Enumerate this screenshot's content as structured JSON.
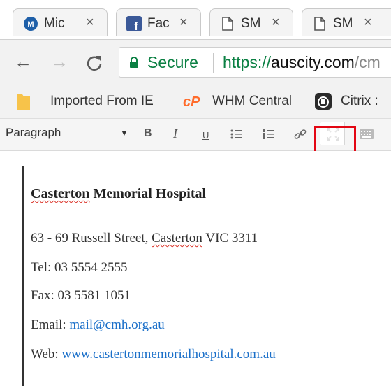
{
  "tabs": [
    {
      "title": "Mic",
      "icon": "m-badge-icon",
      "close": "×"
    },
    {
      "title": "Fac",
      "icon": "facebook-icon",
      "close": "×"
    },
    {
      "title": "SM",
      "icon": "document-icon",
      "close": "×"
    },
    {
      "title": "SM",
      "icon": "document-icon",
      "close": "×"
    }
  ],
  "nav": {
    "back": "←",
    "forward": "→",
    "reload": "C",
    "secure_label": "Secure",
    "url_scheme": "https://",
    "url_host": "auscity.com",
    "url_path": "/cm"
  },
  "bookmarks": [
    {
      "label": "Imported From IE",
      "icon": "folder-icon"
    },
    {
      "label": "WHM Central",
      "icon": "cpanel-icon"
    },
    {
      "label": "Citrix :",
      "icon": "citrix-icon"
    }
  ],
  "toolbar": {
    "format": "Paragraph",
    "caret": "▼",
    "bold": "B",
    "italic": "I",
    "underline": "U",
    "bullet_list": "☰",
    "numbered_list": "☰",
    "link": "🔗"
  },
  "content": {
    "heading_word1": "Casterton",
    "heading_rest": " Memorial Hospital",
    "address_pre": "63 - 69 Russell Street, ",
    "address_town": "Casterton",
    "address_post": " VIC 3311",
    "tel": "Tel: 03 5554 2555",
    "fax": "Fax: 03 5581 1051",
    "email_label": "Email: ",
    "email": "mail@cmh.org.au",
    "web_label": "Web: ",
    "web": "www.castertonmemorialhospital.com.au"
  },
  "colors": {
    "secure_green": "#0b8043",
    "highlight_red": "#e30613",
    "link_blue": "#1a6fc9"
  }
}
